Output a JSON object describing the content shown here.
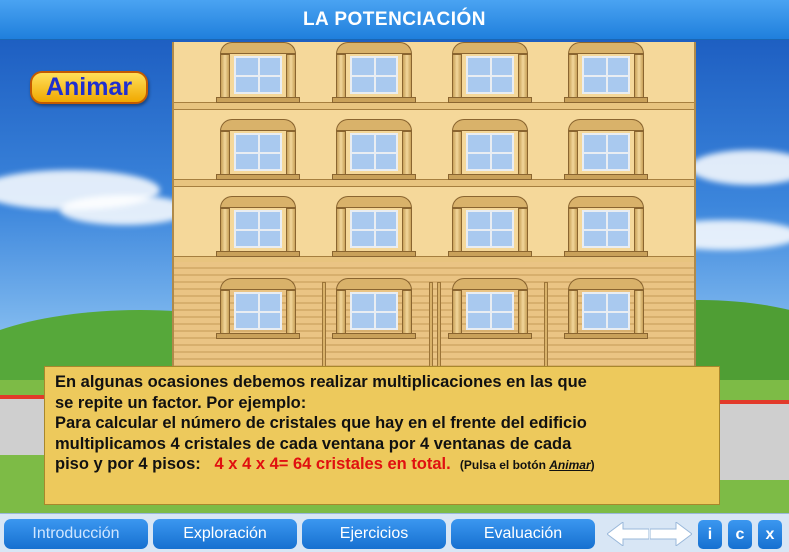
{
  "header": {
    "title": "LA POTENCIACIÓN"
  },
  "animate_button": {
    "label": "Animar"
  },
  "explanation": {
    "line1": "En algunas ocasiones debemos realizar multiplicaciones en las que",
    "line2": "se repite un factor. Por ejemplo:",
    "line3": "Para calcular el número de cristales que hay en el frente del edificio",
    "line4": "multiplicamos 4 cristales de cada ventana por 4 ventanas de cada",
    "line5_start": "piso y por 4 pisos:",
    "formula": "4 x 4 x 4= 64 cristales en total.",
    "hint_prefix": "(Pulsa el botón",
    "hint_button": "Animar",
    "hint_suffix": ")"
  },
  "nav": {
    "tabs": [
      {
        "label": "Introducción"
      },
      {
        "label": "Exploración"
      },
      {
        "label": "Ejercicios"
      },
      {
        "label": "Evaluación"
      }
    ],
    "info_button": "i",
    "credits_button": "c",
    "close_button": "x"
  },
  "icons": {
    "back": "left-arrow-icon",
    "forward": "right-arrow-icon"
  },
  "colors": {
    "header_blue": "#2d8de6",
    "panel_yellow": "#edc95c",
    "highlight_red": "#e01010",
    "button_text_blue": "#1f2fd0"
  }
}
